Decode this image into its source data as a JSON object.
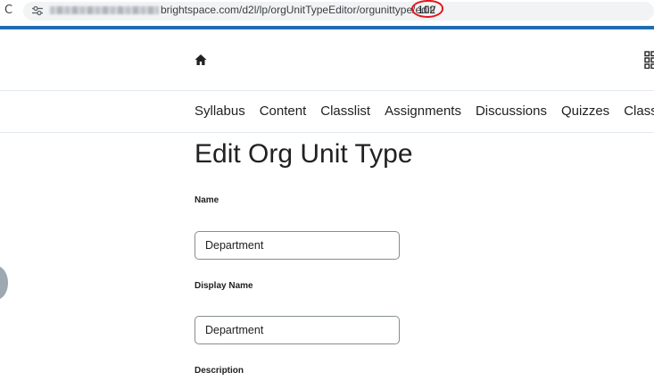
{
  "browser": {
    "url_domain_path": "brightspace.com/d2l/lp/orgUnitTypeEditor/orgunittype/edit/",
    "url_id": "102",
    "reload_glyph": "C",
    "icons": [
      "reload-icon",
      "site-info-icon"
    ],
    "annotation_color": "#e4161d"
  },
  "theme": {
    "brand_line_color": "#1f6cb0",
    "text_color": "#202122",
    "divider_color": "#e3e9f1"
  },
  "minibar": {
    "icons": [
      "home-icon",
      "waffle-icon"
    ]
  },
  "navbar": {
    "items": [
      {
        "label": "Syllabus"
      },
      {
        "label": "Content"
      },
      {
        "label": "Classlist"
      },
      {
        "label": "Assignments"
      },
      {
        "label": "Discussions"
      },
      {
        "label": "Quizzes"
      },
      {
        "label": "Class Pr"
      }
    ]
  },
  "page": {
    "title": "Edit Org Unit Type",
    "form": {
      "name_label": "Name",
      "name_value": "Department",
      "display_name_label": "Display Name",
      "display_name_value": "Department",
      "description_label": "Description"
    }
  }
}
